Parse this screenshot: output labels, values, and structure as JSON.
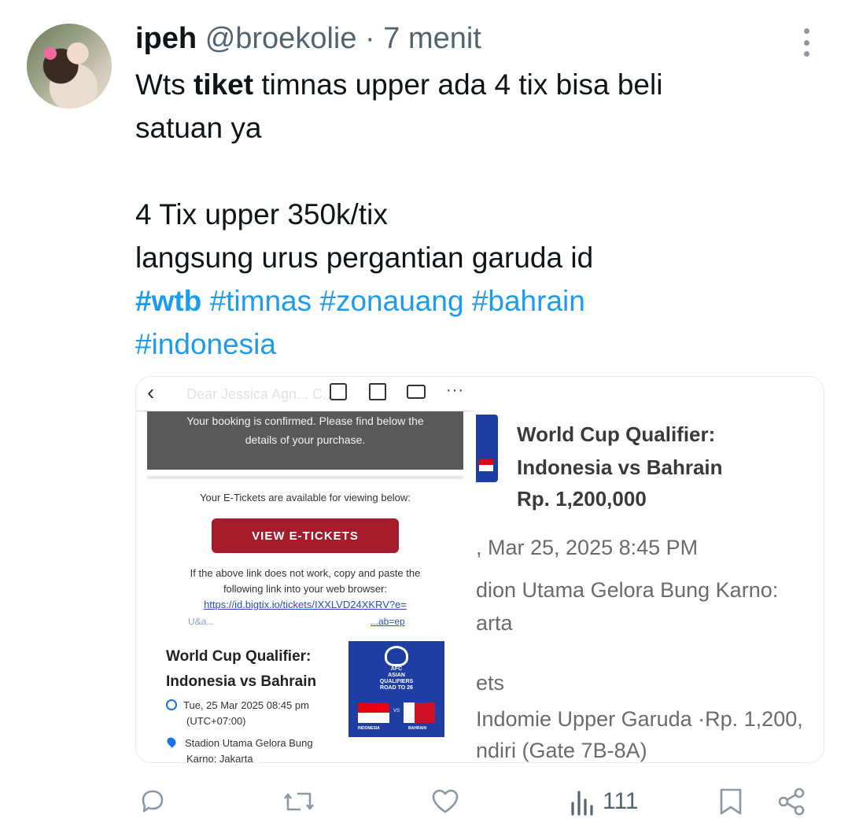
{
  "tweet": {
    "name": "ipeh",
    "handle": "@broekolie",
    "separator": "·",
    "time": "7 menit",
    "line1_a": "Wts ",
    "line1_bold": "tiket",
    "line1_b": " timnas upper ada 4 tix bisa beli",
    "line2": "satuan ya",
    "line3": "4 Tix upper 350k/tix",
    "line4": "langsung urus pergantian garuda id",
    "hashtags_line1": [
      {
        "text": "#wtb",
        "bold": true
      },
      {
        "text": "#timnas",
        "bold": false
      },
      {
        "text": "#zonauang",
        "bold": false
      },
      {
        "text": "#bahrain",
        "bold": false
      }
    ],
    "hashtags_line2": [
      {
        "text": "#indonesia",
        "bold": false
      }
    ]
  },
  "media_left": {
    "back": "‹",
    "ghost_subject": "Dear Jessica Agn... C...",
    "menu_dots": "···",
    "booking_line1": "Your booking is confirmed. Please find below the",
    "booking_line2": "details of your purchase.",
    "eticket_text": "Your E-Tickets are available for viewing below:",
    "view_button": "VIEW E-TICKETS",
    "fallback_line1": "If the above link does not work, copy and paste the",
    "fallback_line2": "following link into your web browser:",
    "link_line1": "https://id.bigtix.io/tickets/IXXLVD24XKRV?e=",
    "link_line2a": "U&a...",
    "link_line2b": "...ab=ep",
    "event_title_1": "World Cup Qualifier:",
    "event_title_2": "Indonesia vs Bahrain",
    "datetime_1": "Tue, 25 Mar 2025 08:45 pm",
    "datetime_2": "(UTC+07:00)",
    "venue_1": "Stadion Utama Gelora Bung",
    "venue_2": "Karno: Jakarta",
    "poster": {
      "afc": "AFC",
      "asian": "ASIAN",
      "qualifiers": "QUALIFIERS",
      "road": "ROAD TO 26",
      "vs": "VS",
      "team1": "INDONESIA",
      "team2": "BAHRAIN"
    }
  },
  "media_right": {
    "title_1": "World Cup Qualifier:",
    "title_2": "Indonesia vs Bahrain",
    "price": "Rp. 1,200,000",
    "date": ", Mar 25, 2025 8:45 PM",
    "venue": "dion Utama Gelora Bung Karno:",
    "city": "arta",
    "tickets": "ets",
    "ticket_line": "Indomie Upper Garuda ·Rp. 1,200,",
    "gate": "ndiri (Gate 7B-8A)"
  },
  "actions": {
    "views": "111"
  },
  "colors": {
    "link": "#1d9bf0",
    "muted": "#536471",
    "button_red": "#a51d2d"
  }
}
